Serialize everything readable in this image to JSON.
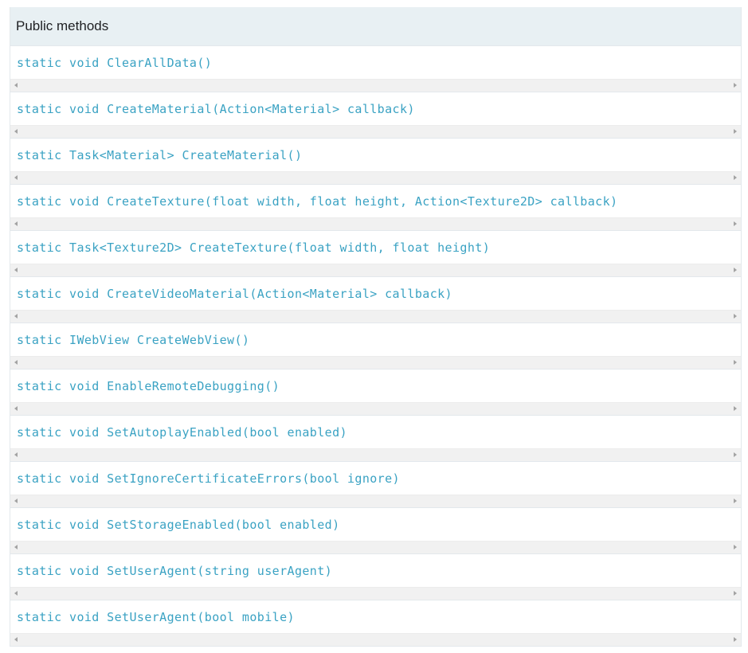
{
  "header": {
    "title": "Public methods"
  },
  "methods": [
    "static void ClearAllData()",
    "static void CreateMaterial(Action<Material> callback)",
    "static Task<Material> CreateMaterial()",
    "static void CreateTexture(float width, float height, Action<Texture2D> callback)",
    "static Task<Texture2D> CreateTexture(float width, float height)",
    "static void CreateVideoMaterial(Action<Material> callback)",
    "static IWebView CreateWebView()",
    "static void EnableRemoteDebugging()",
    "static void SetAutoplayEnabled(bool enabled)",
    "static void SetIgnoreCertificateErrors(bool ignore)",
    "static void SetStorageEnabled(bool enabled)",
    "static void SetUserAgent(string userAgent)",
    "static void SetUserAgent(bool mobile)"
  ],
  "icons": {
    "scroll_left": "triangle-left-icon",
    "scroll_right": "triangle-right-icon"
  },
  "colors": {
    "header_bg": "#e8f0f3",
    "code_text": "#3aa2c3",
    "scrollbar_bg": "#f1f1f1"
  }
}
